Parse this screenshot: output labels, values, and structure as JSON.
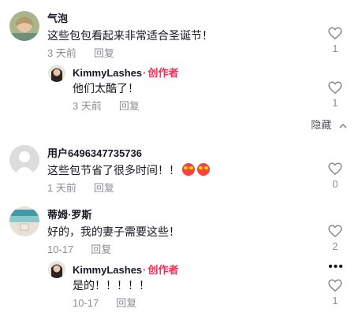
{
  "comments": [
    {
      "name": "气泡",
      "text": "这些包包看起来非常适合圣诞节！",
      "time": "3 天前",
      "reply": "回复",
      "likes": "1"
    },
    {
      "name": "KimmyLashes",
      "badge_dot": "·",
      "badge": "创作者",
      "text": "他们太酷了！",
      "time": "3 天前",
      "reply": "回复",
      "likes": "1"
    },
    {
      "name": "用户6496347735736",
      "text": "这些包节省了很多时间！！",
      "time": "1 天前",
      "reply": "回复",
      "likes": "0"
    },
    {
      "name": "蒂姆·罗斯",
      "text": "好的，我的妻子需要这些！",
      "time": "10-17",
      "reply": "回复",
      "likes": "2"
    },
    {
      "name": "KimmyLashes",
      "badge_dot": "·",
      "badge": "创作者",
      "text": "是的！！！！！",
      "time": "10-17",
      "reply": "回复",
      "likes": "1"
    }
  ],
  "hide_label": "隐藏",
  "more_label": "•••",
  "icons": {
    "like": "heart-outline-icon",
    "hide": "chevron-up-icon",
    "emoji": "star-struck-emoji-icon"
  },
  "colors": {
    "creator_badge": "#fe2c55",
    "secondary_text": "#8a8b91"
  }
}
